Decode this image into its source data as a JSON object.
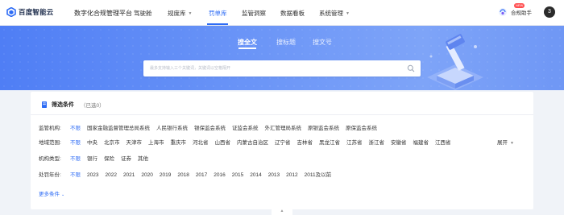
{
  "header": {
    "logo_text": "百度智能云",
    "platform_name": "数字化合规管理平台",
    "nav": [
      {
        "label": "驾驶舱",
        "has_caret": false,
        "active": false
      },
      {
        "label": "规度库",
        "has_caret": true,
        "active": false
      },
      {
        "label": "罚单库",
        "has_caret": false,
        "active": true
      },
      {
        "label": "监管洞察",
        "has_caret": false,
        "active": false
      },
      {
        "label": "数据看板",
        "has_caret": false,
        "active": false
      },
      {
        "label": "系统管理",
        "has_caret": true,
        "active": false
      }
    ],
    "assistant_label": "合规助手",
    "assistant_badge": "NEW",
    "avatar_initial": "3"
  },
  "hero": {
    "tabs": [
      {
        "label": "搜全文",
        "active": true
      },
      {
        "label": "搜标题",
        "active": false
      },
      {
        "label": "搜文号",
        "active": false
      }
    ],
    "search_placeholder": "最多支持输入三个关键词，关键词以空格隔开",
    "search_value": ""
  },
  "filters": {
    "title": "筛选条件",
    "selected_text": "（已选0）",
    "rows": [
      {
        "label": "监管机构:",
        "options": [
          "不限",
          "国家金融监督管理总局系统",
          "人民银行系统",
          "银保监会系统",
          "证监会系统",
          "外汇管理局系统",
          "原银监会系统",
          "原保监会系统"
        ],
        "active_index": 0,
        "expand_label": ""
      },
      {
        "label": "地域范围:",
        "options": [
          "不限",
          "中央",
          "北京市",
          "天津市",
          "上海市",
          "重庆市",
          "河北省",
          "山西省",
          "内蒙古自治区",
          "辽宁省",
          "吉林省",
          "黑龙江省",
          "江苏省",
          "浙江省",
          "安徽省",
          "福建省",
          "江西省"
        ],
        "active_index": 0,
        "expand_label": "展开"
      },
      {
        "label": "机构类型:",
        "options": [
          "不限",
          "银行",
          "保险",
          "证券",
          "其他"
        ],
        "active_index": 0,
        "expand_label": ""
      },
      {
        "label": "处罚年份:",
        "options": [
          "不限",
          "2023",
          "2022",
          "2021",
          "2020",
          "2019",
          "2018",
          "2017",
          "2016",
          "2015",
          "2014",
          "2013",
          "2012",
          "2011及以前"
        ],
        "active_index": 0,
        "expand_label": ""
      }
    ],
    "more_label": "更多条件"
  },
  "colors": {
    "accent": "#2e6cf5",
    "hero_start": "#4f7ef5",
    "hero_end": "#7ea4f8",
    "page_bg": "#f0f3f8"
  }
}
